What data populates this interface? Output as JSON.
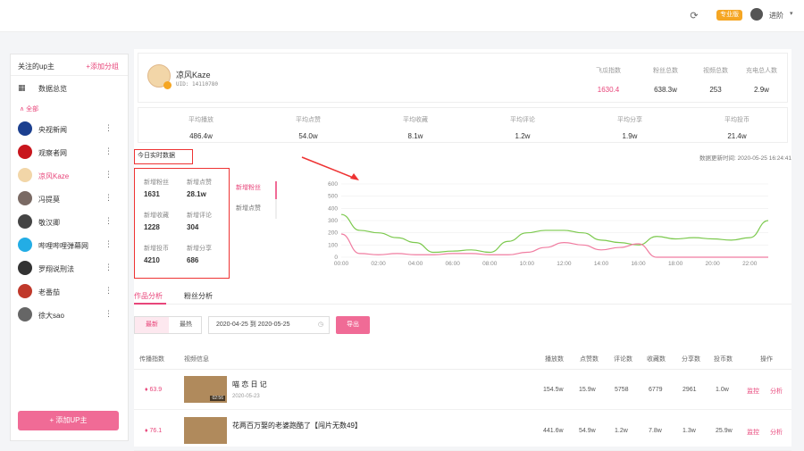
{
  "topbar": {
    "vip_badge": "专业版",
    "username": "进阶",
    "refresh_icon": "refresh-icon"
  },
  "sidebar": {
    "title": "关注的up主",
    "add_group": "+添加分组",
    "overview": "数据总览",
    "group_label": "全部",
    "items": [
      {
        "label": "央视新闻",
        "color": "#1b3f8f"
      },
      {
        "label": "观察者网",
        "color": "#c8161d"
      },
      {
        "label": "凉风Kaze",
        "color": "#f2d6a8",
        "active": true
      },
      {
        "label": "冯提莫",
        "color": "#7a6a64"
      },
      {
        "label": "敬汉卿",
        "color": "#444444"
      },
      {
        "label": "哔哩哔哩弹幕网",
        "color": "#23ade5"
      },
      {
        "label": "罗翔说刑法",
        "color": "#333333"
      },
      {
        "label": "老番茄",
        "color": "#c0392b"
      },
      {
        "label": "徐大sao",
        "color": "#666666"
      }
    ],
    "add_button": "+ 添加UP主"
  },
  "profile": {
    "name": "凉风Kaze",
    "uid": "UID: 14110780",
    "stats": [
      {
        "label": "飞瓜指数",
        "value": "1630.4",
        "pink": true
      },
      {
        "label": "粉丝总数",
        "value": "638.3w"
      },
      {
        "label": "视频总数",
        "value": "253"
      },
      {
        "label": "充电总人数",
        "value": "2.9w"
      }
    ]
  },
  "averages": [
    {
      "label": "平均播放",
      "value": "486.4w"
    },
    {
      "label": "平均点赞",
      "value": "54.0w"
    },
    {
      "label": "平均收藏",
      "value": "8.1w"
    },
    {
      "label": "平均评论",
      "value": "1.2w"
    },
    {
      "label": "平均分享",
      "value": "1.9w"
    },
    {
      "label": "平均投币",
      "value": "21.4w"
    }
  ],
  "realtime": {
    "title": "今日实时数据",
    "updated": "数据更新时间: 2020-05-25 16:24:41",
    "cells": [
      {
        "label": "新增粉丝",
        "value": "1631"
      },
      {
        "label": "新增点赞",
        "value": "28.1w"
      },
      {
        "label": "新增收藏",
        "value": "1228"
      },
      {
        "label": "新增评论",
        "value": "304"
      },
      {
        "label": "新增投币",
        "value": "4210"
      },
      {
        "label": "新增分享",
        "value": "686"
      }
    ],
    "tabs": [
      "新增粉丝",
      "新增点赞"
    ]
  },
  "chart_data": {
    "type": "line",
    "x": [
      "00:00",
      "01:00",
      "02:00",
      "03:00",
      "04:00",
      "05:00",
      "06:00",
      "07:00",
      "08:00",
      "09:00",
      "10:00",
      "11:00",
      "12:00",
      "13:00",
      "14:00",
      "15:00",
      "16:00",
      "17:00",
      "18:00",
      "19:00",
      "20:00",
      "21:00",
      "22:00",
      "23:00"
    ],
    "xticks": [
      "00:00",
      "02:00",
      "04:00",
      "06:00",
      "08:00",
      "10:00",
      "12:00",
      "14:00",
      "16:00",
      "18:00",
      "20:00",
      "22:00"
    ],
    "ylim": [
      0,
      600
    ],
    "yticks": [
      0,
      100,
      200,
      300,
      400,
      500,
      600
    ],
    "series": [
      {
        "color": "#7cc94e",
        "values": [
          350,
          220,
          200,
          160,
          120,
          40,
          50,
          60,
          40,
          130,
          200,
          220,
          220,
          200,
          140,
          120,
          100,
          170,
          150,
          160,
          150,
          140,
          160,
          300
        ]
      },
      {
        "color": "#f07ca0",
        "values": [
          190,
          30,
          20,
          30,
          20,
          20,
          30,
          30,
          20,
          20,
          40,
          80,
          120,
          100,
          60,
          80,
          110,
          0,
          0,
          0,
          0,
          0,
          0,
          0
        ]
      }
    ],
    "grid": true
  },
  "tabs": [
    "作品分析",
    "粉丝分析"
  ],
  "filter": {
    "seg": [
      "最新",
      "最热"
    ],
    "range": "2020-04-25 到 2020-05-25",
    "export": "导出"
  },
  "table": {
    "headers": [
      "传播指数",
      "视频信息",
      "播放数",
      "点赞数",
      "评论数",
      "收藏数",
      "分享数",
      "投币数",
      "操作"
    ],
    "rows": [
      {
        "index": "63.9",
        "title": "喵 恋 日 记",
        "date": "2020-05-23",
        "duration": "02:56",
        "play": "154.5w",
        "like": "15.9w",
        "comment": "5758",
        "fav": "6779",
        "share": "2961",
        "coin": "1.0w",
        "monitor": "监控",
        "analyze": "分析"
      },
      {
        "index": "76.1",
        "title": "花两百万娶的老婆跑酷了【闯片无数49】",
        "date": "",
        "duration": "",
        "play": "441.6w",
        "like": "54.9w",
        "comment": "1.2w",
        "fav": "7.8w",
        "share": "1.3w",
        "coin": "25.9w",
        "monitor": "监控",
        "analyze": "分析"
      }
    ]
  }
}
